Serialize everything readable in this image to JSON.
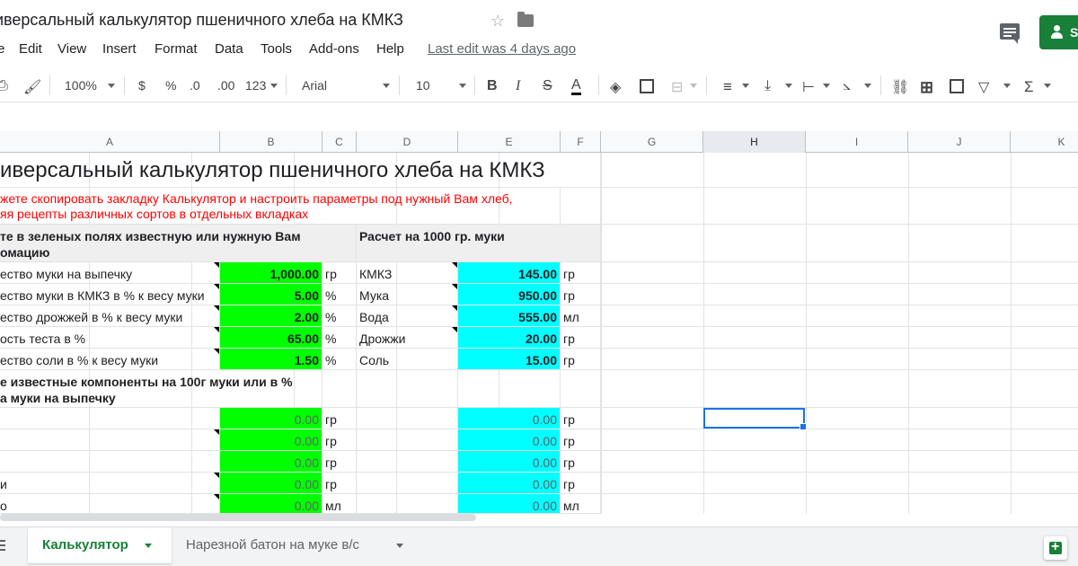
{
  "titlebar": {
    "title": "иверсальный калькулятор пшеничного хлеба на КМКЗ",
    "share_label": "S"
  },
  "menu": {
    "items": [
      "e",
      "Edit",
      "View",
      "Insert",
      "Format",
      "Data",
      "Tools",
      "Add-ons",
      "Help"
    ],
    "last_edit": "Last edit was 4 days ago"
  },
  "toolbar": {
    "zoom": "100%",
    "currency": "$",
    "percent": "%",
    "decrease_decimals": ".0",
    "increase_decimals": ".00",
    "more_formats": "123",
    "font": "Arial",
    "font_size": "10",
    "bold": "B",
    "italic": "I",
    "strikethrough": "S",
    "text_color": "A",
    "functions": "Σ"
  },
  "columns": [
    "A",
    "B",
    "C",
    "D",
    "E",
    "F",
    "G",
    "H",
    "I",
    "J",
    "K"
  ],
  "sheet": {
    "title_row": "иверсальный калькулятор пшеничного хлеба на КМКЗ",
    "note_line1": "жете скопировать закладку Калькулятор и настроить параметры под нужный Вам хлеб,",
    "note_line2": "яя рецепты различных сортов в отдельных вкладках",
    "input_header_line1": "те в зеленых полях известную или нужную Вам",
    "input_header_line2": "омацию",
    "calc_header": "Расчет на 1000 гр. муки",
    "inputs": [
      {
        "label": "ество муки на выпечку",
        "value": "1,000.00",
        "unit": "гр"
      },
      {
        "label": "ество муки в КМКЗ в % к весу муки",
        "value": "5.00",
        "unit": "%"
      },
      {
        "label": "ество дрожжей в % к весу муки",
        "value": "2.00",
        "unit": "%"
      },
      {
        "label": "ость теста  в %",
        "value": "65.00",
        "unit": "%"
      },
      {
        "label": "ество соли в % к весу муки",
        "value": "1.50",
        "unit": "%"
      }
    ],
    "results": [
      {
        "label": "КМКЗ",
        "value": "145.00",
        "unit": "гр"
      },
      {
        "label": "Мука",
        "value": "950.00",
        "unit": "гр"
      },
      {
        "label": "Вода",
        "value": "555.00",
        "unit": "мл"
      },
      {
        "label": "Дрожжи",
        "value": "20.00",
        "unit": "гр"
      },
      {
        "label": "Соль",
        "value": "15.00",
        "unit": "гр"
      }
    ],
    "components_header_line1": "е известные компоненты на 100г муки или в %",
    "components_header_line2": "а муки на выпечку",
    "components": [
      {
        "label": "",
        "value": "0.00",
        "unit": "гр",
        "result": "0.00",
        "result_unit": "гр"
      },
      {
        "label": "",
        "value": "0.00",
        "unit": "гр",
        "result": "0.00",
        "result_unit": "гр"
      },
      {
        "label": "",
        "value": "0.00",
        "unit": "гр",
        "result": "0.00",
        "result_unit": "гр"
      },
      {
        "label": "и",
        "value": "0.00",
        "unit": "гр",
        "result": "0.00",
        "result_unit": "гр"
      },
      {
        "label": "о",
        "value": "0.00",
        "unit": "мл",
        "result": "0.00",
        "result_unit": "мл"
      }
    ]
  },
  "tabs": [
    {
      "label": "Калькулятор"
    },
    {
      "label": "Нарезной батон на муке в/с"
    }
  ],
  "colors": {
    "input_fill": "#00ff00",
    "result_fill": "#00ffff",
    "note_text": "#ff0000",
    "brand_green": "#188038"
  }
}
